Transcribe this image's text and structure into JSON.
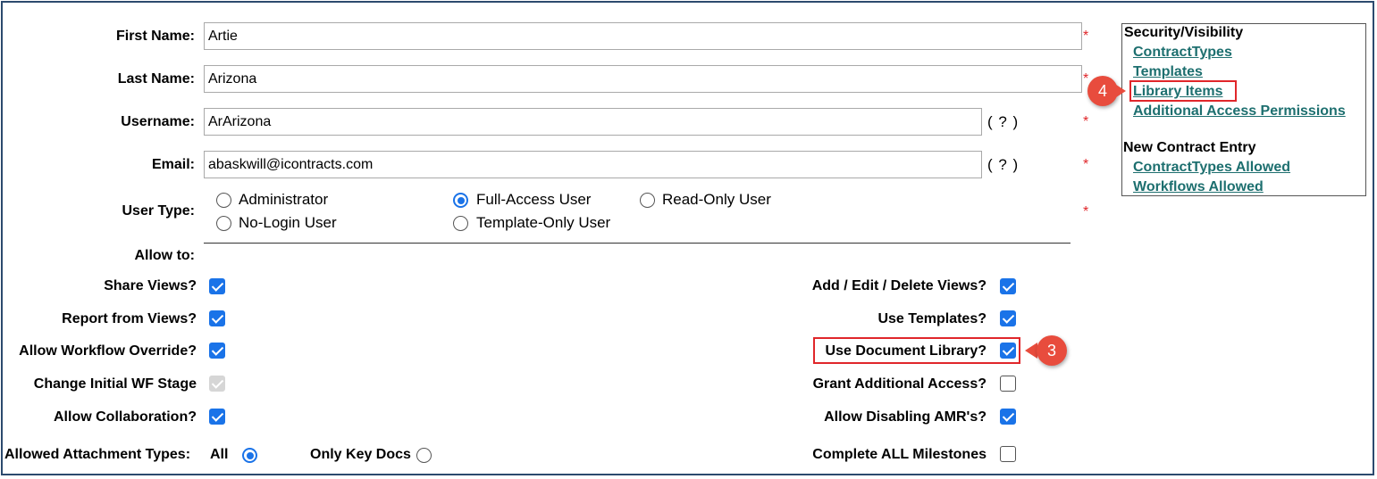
{
  "form": {
    "first_name": {
      "label": "First Name:",
      "value": "Artie",
      "required": "*"
    },
    "last_name": {
      "label": "Last Name:",
      "value": "Arizona",
      "required": "*"
    },
    "username": {
      "label": "Username:",
      "value": "ArArizona",
      "help": "( ? )",
      "required": "*"
    },
    "email": {
      "label": "Email:",
      "value": "abaskwill@icontracts.com",
      "help": "( ? )",
      "required": "*"
    },
    "user_type": {
      "label": "User Type:",
      "required": "*",
      "options": [
        "Administrator",
        "Full-Access User",
        "Read-Only User",
        "No-Login User",
        "Template-Only User"
      ],
      "selected": "Full-Access User"
    },
    "allow_to_label": "Allow to:"
  },
  "permissions_left": [
    {
      "label": "Share Views?",
      "checked": true
    },
    {
      "label": "Report from Views?",
      "checked": true
    },
    {
      "label": "Allow Workflow Override?",
      "checked": true
    },
    {
      "label": "Change Initial WF Stage",
      "checked": true,
      "disabled": true
    },
    {
      "label": "Allow Collaboration?",
      "checked": true
    }
  ],
  "permissions_right": [
    {
      "label": "Add / Edit / Delete Views?",
      "checked": true
    },
    {
      "label": "Use Templates?",
      "checked": true
    },
    {
      "label": "Use Document Library?",
      "checked": true
    },
    {
      "label": "Grant Additional Access?",
      "checked": false
    },
    {
      "label": "Allow Disabling AMR's?",
      "checked": true
    },
    {
      "label": "Complete ALL Milestones",
      "checked": false
    }
  ],
  "attachments": {
    "label": "Allowed Attachment Types:",
    "options": [
      "All",
      "Only Key Docs"
    ],
    "selected": "All"
  },
  "side_panel": {
    "security_heading": "Security/Visibility",
    "security_links": [
      "ContractTypes",
      "Templates",
      "Library Items",
      "Additional Access Permissions"
    ],
    "entry_heading": "New Contract Entry",
    "entry_links": [
      "ContractTypes Allowed",
      "Workflows Allowed"
    ]
  },
  "callouts": {
    "step_3": "3",
    "step_4": "4"
  },
  "colors": {
    "accent": "#1a73e8",
    "link": "#1d6f6f",
    "required": "#e0262a",
    "callout": "#e84c3d",
    "frame": "#2c4a6e"
  }
}
